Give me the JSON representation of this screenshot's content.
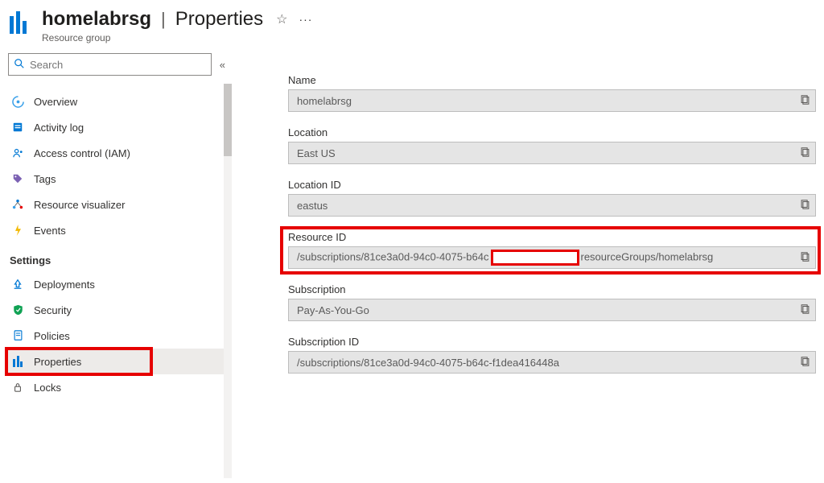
{
  "header": {
    "title": "homelabrsg",
    "page": "Properties",
    "subtitle": "Resource group"
  },
  "search": {
    "placeholder": "Search"
  },
  "sidebar": {
    "items": [
      {
        "label": "Overview"
      },
      {
        "label": "Activity log"
      },
      {
        "label": "Access control (IAM)"
      },
      {
        "label": "Tags"
      },
      {
        "label": "Resource visualizer"
      },
      {
        "label": "Events"
      }
    ],
    "section_settings": "Settings",
    "settings_items": [
      {
        "label": "Deployments"
      },
      {
        "label": "Security"
      },
      {
        "label": "Policies"
      },
      {
        "label": "Properties"
      },
      {
        "label": "Locks"
      }
    ]
  },
  "fields": {
    "name_label": "Name",
    "name_value": "homelabrsg",
    "location_label": "Location",
    "location_value": "East US",
    "locationid_label": "Location ID",
    "locationid_value": "eastus",
    "resourceid_label": "Resource ID",
    "resourceid_value_prefix": "/subscriptions/81ce3a0d-94c0-4075-b64c",
    "resourceid_value_suffix": "resourceGroups/homelabrsg",
    "subscription_label": "Subscription",
    "subscription_value": "Pay-As-You-Go",
    "subscriptionid_label": "Subscription ID",
    "subscriptionid_value": "/subscriptions/81ce3a0d-94c0-4075-b64c-f1dea416448a"
  }
}
